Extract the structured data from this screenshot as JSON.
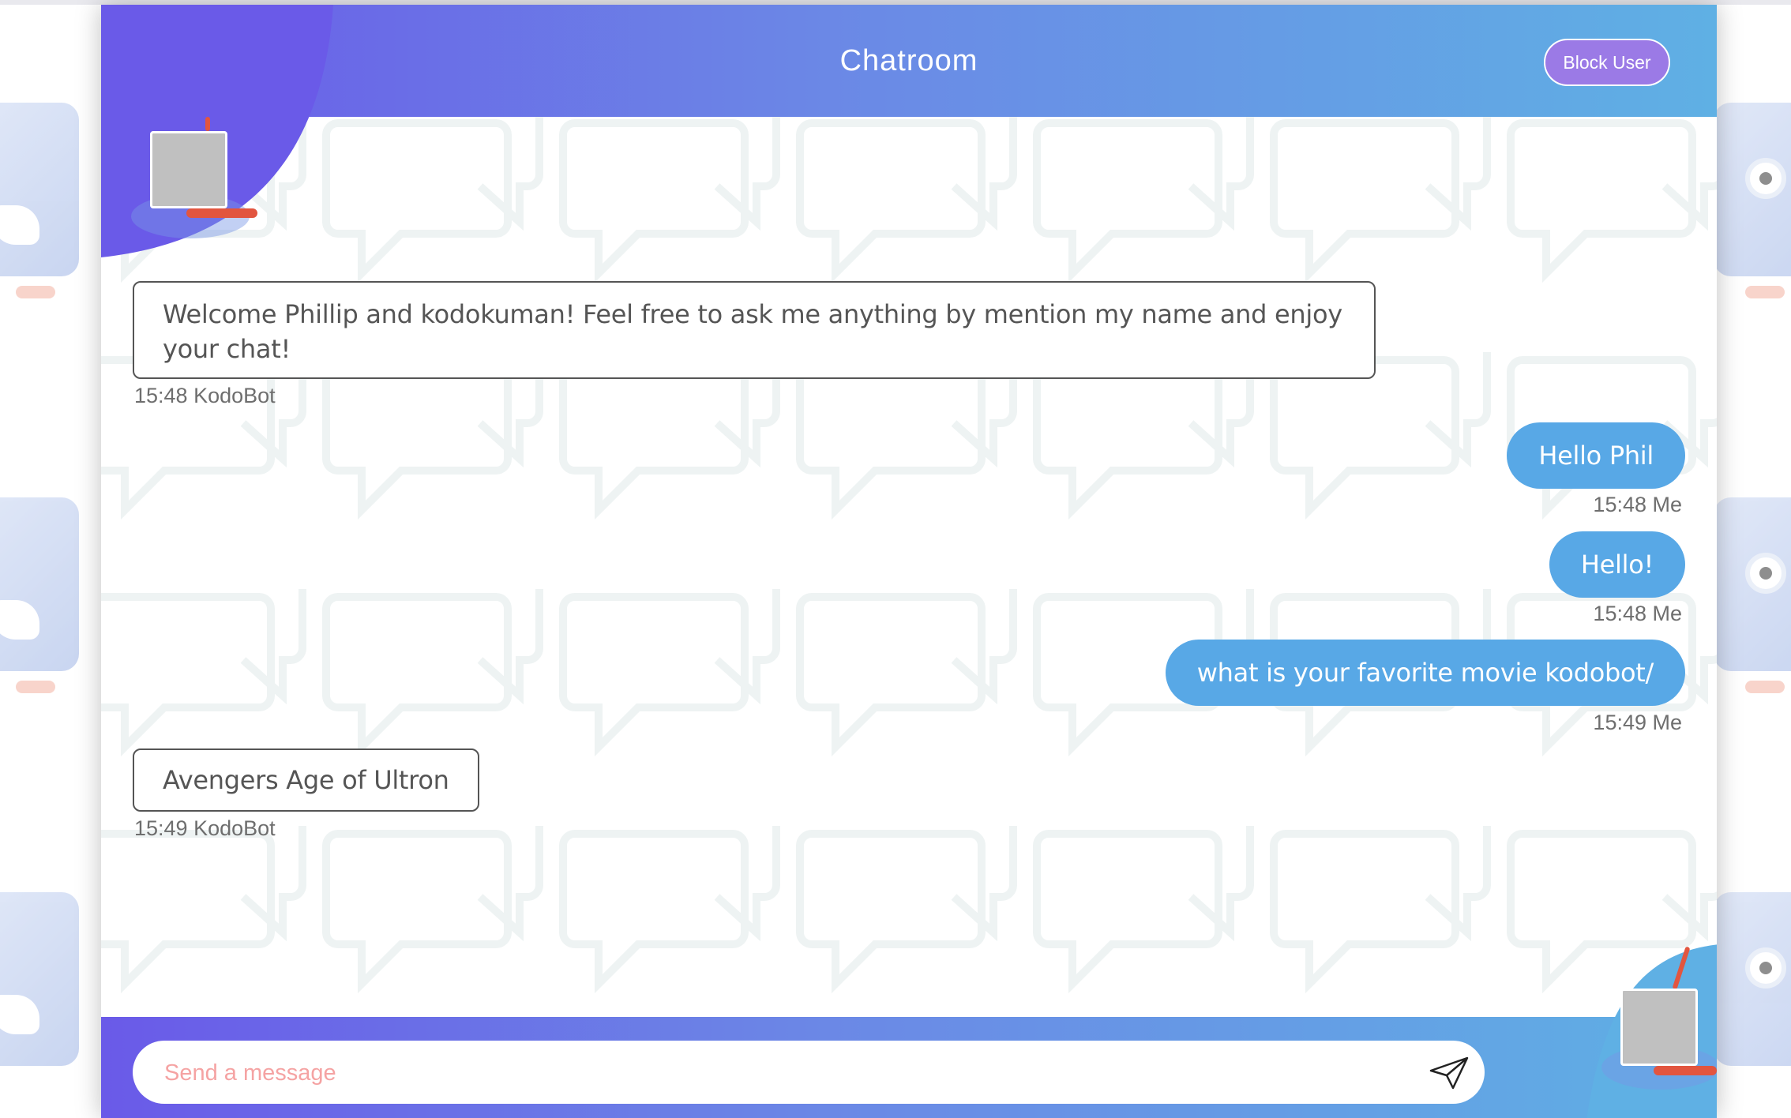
{
  "header": {
    "title": "Chatroom",
    "block_label": "Block User"
  },
  "messages": [
    {
      "sender": "KodoBot",
      "text": "Welcome Phillip and kodokuman! Feel free to ask me anything by mention my name and enjoy your chat!",
      "time": "15:48",
      "meta": "15:48 KodoBot"
    },
    {
      "sender": "Me",
      "text": "Hello Phil",
      "time": "15:48",
      "meta": "15:48 Me"
    },
    {
      "sender": "Me",
      "text": "Hello!",
      "time": "15:48",
      "meta": "15:48 Me"
    },
    {
      "sender": "Me",
      "text": "what is your favorite movie kodobot/",
      "time": "15:49",
      "meta": "15:49 Me"
    },
    {
      "sender": "KodoBot",
      "text": "Avengers Age of Ultron",
      "time": "15:49",
      "meta": "15:49 KodoBot"
    }
  ],
  "composer": {
    "placeholder": "Send a message"
  },
  "icons": {
    "back": "chevron-left-icon",
    "send": "paper-plane-icon"
  },
  "colors": {
    "header_gradient_start": "#6a5ae8",
    "header_gradient_end": "#5fb0e4",
    "my_bubble": "#58a8e6",
    "placeholder": "#f5a3a3"
  }
}
